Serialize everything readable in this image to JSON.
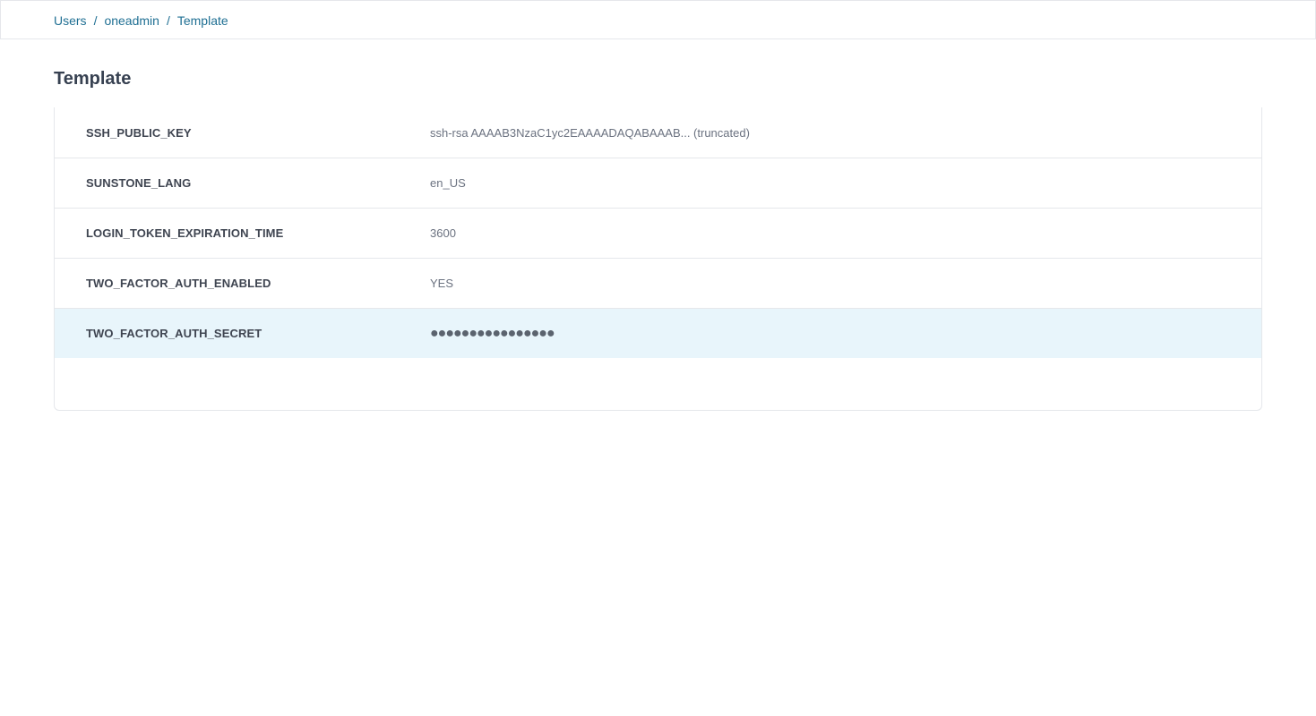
{
  "breadcrumb": {
    "items": [
      "Users",
      "oneadmin",
      "Template"
    ],
    "separator": "/"
  },
  "page": {
    "title": "Template"
  },
  "template_rows": [
    {
      "key": "SSH_PUBLIC_KEY",
      "value": "ssh-rsa AAAAB3NzaC1yc2EAAAADAQABAAAB... (truncated)"
    },
    {
      "key": "SUNSTONE_LANG",
      "value": "en_US"
    },
    {
      "key": "LOGIN_TOKEN_EXPIRATION_TIME",
      "value": "3600"
    },
    {
      "key": "TWO_FACTOR_AUTH_ENABLED",
      "value": "YES"
    },
    {
      "key": "TWO_FACTOR_AUTH_SECRET",
      "value": "●●●●●●●●●●●●●●●●",
      "highlighted": true
    }
  ],
  "colors": {
    "link": "#1f6f93",
    "highlight_row": "#e8f5fb",
    "border": "#e5e7eb"
  }
}
